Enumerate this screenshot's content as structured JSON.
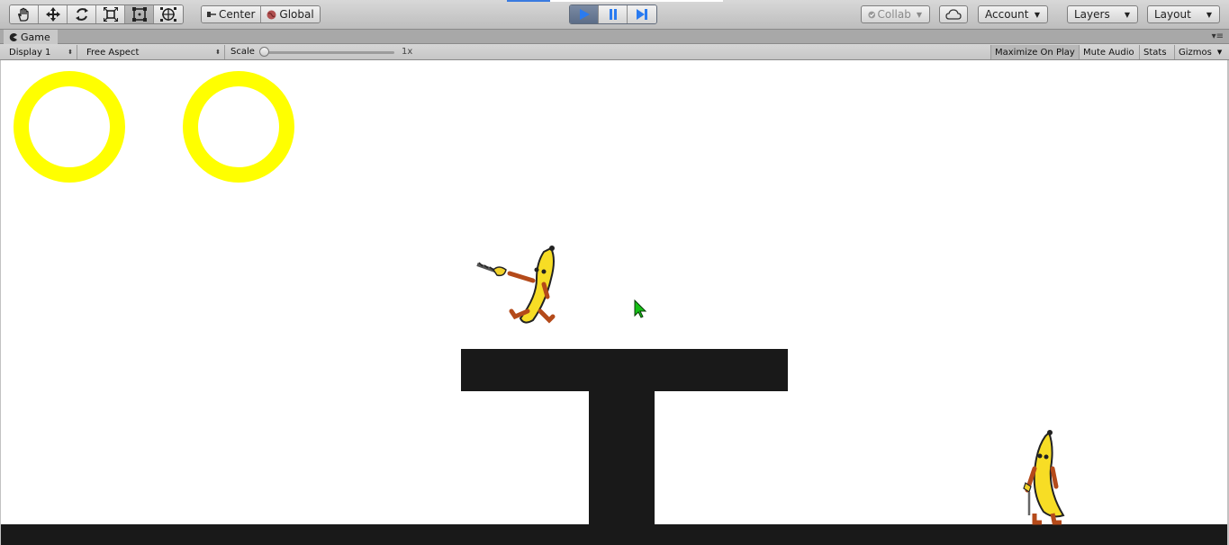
{
  "toolbar": {
    "tools": [
      {
        "icon": "hand-icon",
        "name": "Hand"
      },
      {
        "icon": "move-icon",
        "name": "Move"
      },
      {
        "icon": "rotate-icon",
        "name": "Rotate"
      },
      {
        "icon": "scale-icon",
        "name": "Scale"
      },
      {
        "icon": "rect-icon",
        "name": "Rect",
        "active": true
      },
      {
        "icon": "transform-icon",
        "name": "Transform"
      }
    ],
    "pivot": {
      "center_label": "Center",
      "global_label": "Global"
    },
    "playback": {
      "play_active": true,
      "accent_color": "#2a7bf0"
    },
    "collab_label": "Collab",
    "account_label": "Account",
    "layers_label": "Layers",
    "layout_label": "Layout"
  },
  "game_window": {
    "tab_title": "Game",
    "display_select": "Display 1",
    "aspect_select": "Free Aspect",
    "scale_label": "Scale",
    "scale_value": "1x",
    "maximize_label": "Maximize On Play",
    "mute_label": "Mute Audio",
    "stats_label": "Stats",
    "gizmos_label": "Gizmos"
  },
  "scene": {
    "ring_color": "#ffff00",
    "platform_color": "#191919",
    "background_color": "#ffffff",
    "rings": 2
  }
}
